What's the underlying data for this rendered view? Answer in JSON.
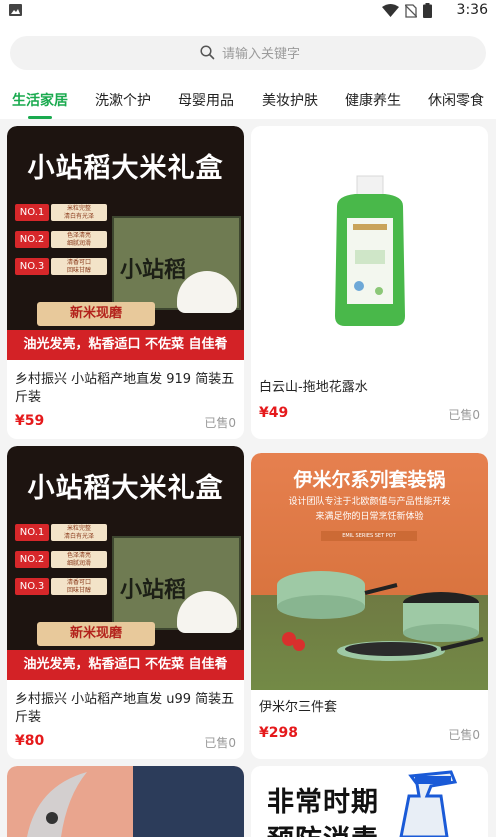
{
  "status_bar": {
    "time": "3:36"
  },
  "search": {
    "placeholder": "请输入关键字"
  },
  "tabs": [
    {
      "label": "生活家居",
      "active": true
    },
    {
      "label": "洗漱个护"
    },
    {
      "label": "母婴用品"
    },
    {
      "label": "美妆护肤"
    },
    {
      "label": "健康养生"
    },
    {
      "label": "休闲零食"
    }
  ],
  "products": [
    {
      "title": "乡村振兴 小站稻产地直发 919 简装五斤装",
      "price": "¥59",
      "sold": "已售0",
      "poster": {
        "heading": "小站稻大米礼盒",
        "tags": [
          {
            "no": "NO.1",
            "desc": "米粒完整\n清白有光泽"
          },
          {
            "no": "NO.2",
            "desc": "色泽清亮\n细腻润滑"
          },
          {
            "no": "NO.3",
            "desc": "清香可口\n回味甘醇"
          }
        ],
        "brand": "小站稻",
        "ribbon": "新米现磨",
        "slogan": "油光发亮，粘香适口 不佐菜 自佳肴"
      }
    },
    {
      "title": "白云山-拖地花露水",
      "price": "¥49",
      "sold": "已售0"
    },
    {
      "title": "乡村振兴 小站稻产地直发 u99 简装五斤装",
      "price": "¥80",
      "sold": "已售0",
      "poster": {
        "heading": "小站稻大米礼盒",
        "tags": [
          {
            "no": "NO.1",
            "desc": "米粒完整\n清白有光泽"
          },
          {
            "no": "NO.2",
            "desc": "色泽清亮\n细腻润滑"
          },
          {
            "no": "NO.3",
            "desc": "清香可口\n回味甘醇"
          }
        ],
        "brand": "小站稻",
        "ribbon": "新米现磨",
        "slogan": "油光发亮，粘香适口 不佐菜 自佳肴"
      }
    },
    {
      "title": "伊米尔三件套",
      "price": "¥298",
      "sold": "已售0",
      "poster": {
        "heading": "伊米尔系列套装锅",
        "sub1": "设计团队专注于北欧颜值与产品性能开发",
        "sub2": "来满足你的日常烹饪新体验",
        "bar": "EMIL SERIES SET POT"
      }
    },
    {
      "poster": {
        "heading1": "非常时期",
        "heading2": "预防消毒"
      }
    }
  ],
  "colors": {
    "accent": "#1aaa4f",
    "price": "#e5191b",
    "background": "#f4f4f4"
  }
}
